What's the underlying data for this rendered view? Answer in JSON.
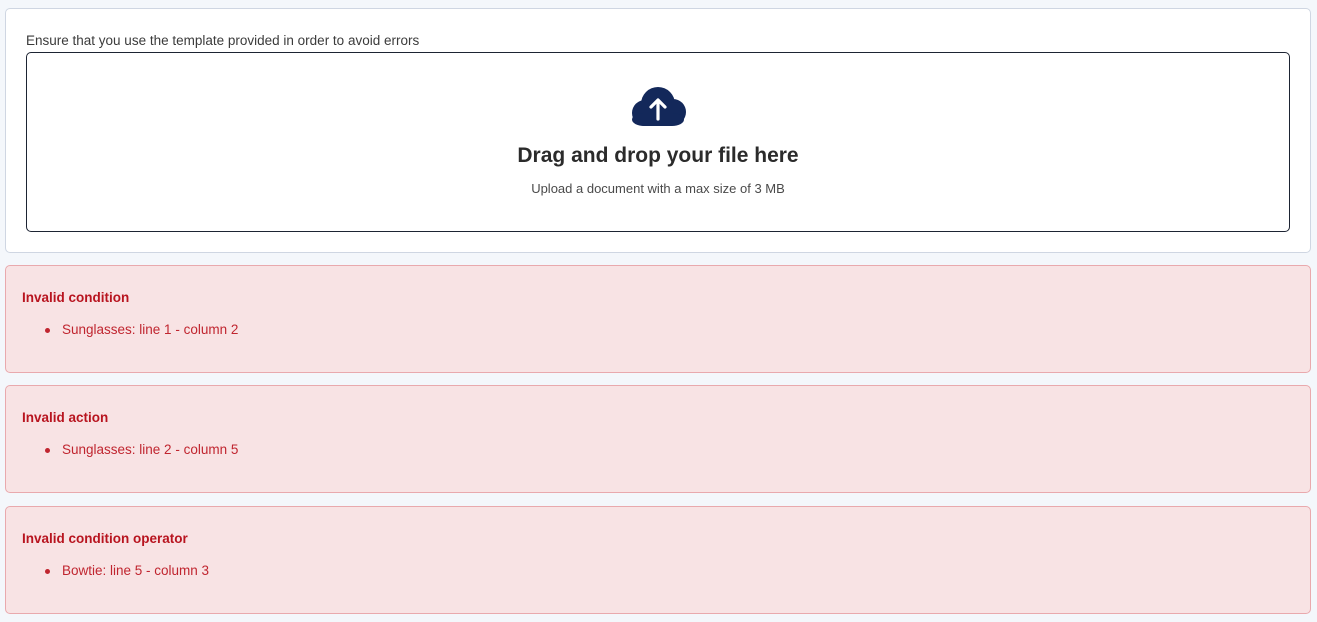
{
  "upload": {
    "hint": "Ensure that you use the template provided in order to avoid errors",
    "title": "Drag and drop your file here",
    "subtitle": "Upload a document with a max size of 3 MB",
    "icon": "cloud-upload-icon",
    "icon_color": "#13285a"
  },
  "colors": {
    "error_bg": "#f8e3e4",
    "error_border": "#e9a9ad",
    "error_text": "#c0252f"
  },
  "errors": [
    {
      "title": "Invalid condition",
      "items": [
        "Sunglasses: line 1 - column 2"
      ]
    },
    {
      "title": "Invalid action",
      "items": [
        "Sunglasses: line 2 - column 5"
      ]
    },
    {
      "title": "Invalid condition operator",
      "items": [
        "Bowtie: line 5 - column 3"
      ]
    }
  ]
}
